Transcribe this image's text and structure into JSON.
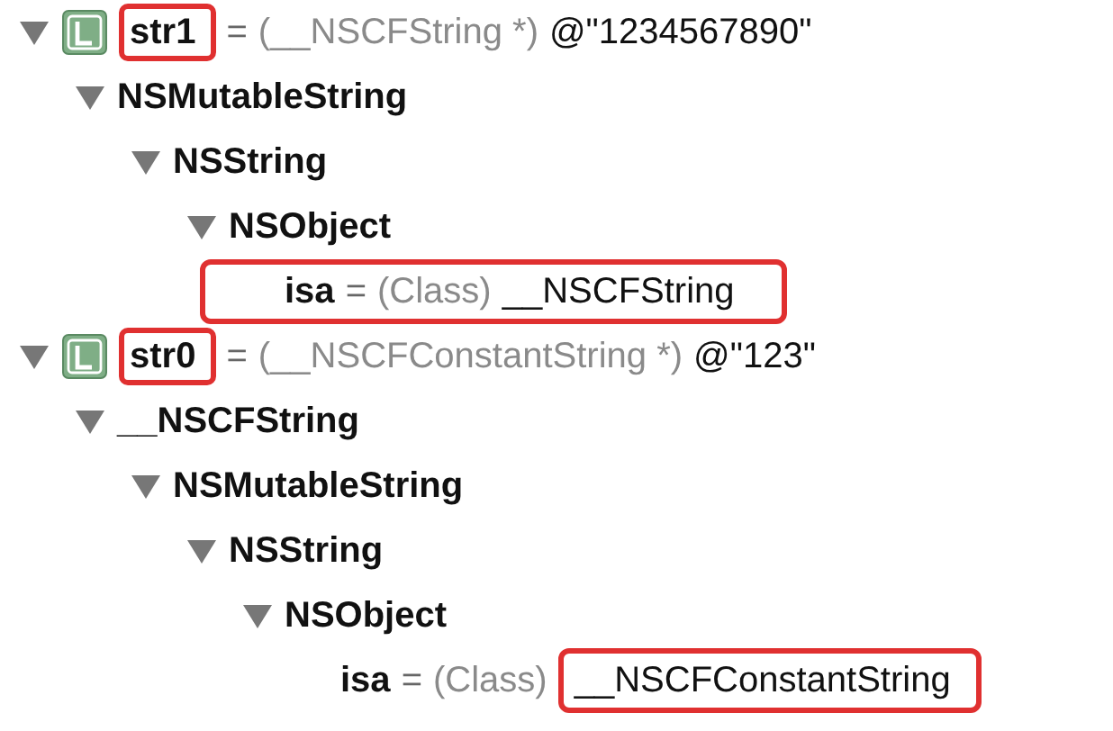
{
  "variables": [
    {
      "local": true,
      "name": "str1",
      "operator": "=",
      "type": "(__NSCFString *)",
      "value": "@\"1234567890\"",
      "expanded": true,
      "name_boxed": true,
      "row_boxed": false,
      "value_boxed": false,
      "children": [
        {
          "local": false,
          "name": "NSMutableString",
          "expanded": true,
          "name_boxed": false,
          "row_boxed": false,
          "value_boxed": false,
          "children": [
            {
              "local": false,
              "name": "NSString",
              "expanded": true,
              "name_boxed": false,
              "row_boxed": false,
              "value_boxed": false,
              "children": [
                {
                  "local": false,
                  "name": "NSObject",
                  "expanded": true,
                  "name_boxed": false,
                  "row_boxed": false,
                  "value_boxed": false,
                  "children": [
                    {
                      "local": false,
                      "name": "isa",
                      "operator": "=",
                      "type": "(Class)",
                      "value": "__NSCFString",
                      "name_boxed": false,
                      "row_boxed": true,
                      "value_boxed": false
                    }
                  ]
                }
              ]
            }
          ]
        }
      ]
    },
    {
      "local": true,
      "name": "str0",
      "operator": "=",
      "type": "(__NSCFConstantString *)",
      "value": "@\"123\"",
      "expanded": true,
      "name_boxed": true,
      "row_boxed": false,
      "value_boxed": false,
      "children": [
        {
          "local": false,
          "name": "__NSCFString",
          "expanded": true,
          "name_boxed": false,
          "row_boxed": false,
          "value_boxed": false,
          "children": [
            {
              "local": false,
              "name": "NSMutableString",
              "expanded": true,
              "name_boxed": false,
              "row_boxed": false,
              "value_boxed": false,
              "children": [
                {
                  "local": false,
                  "name": "NSString",
                  "expanded": true,
                  "name_boxed": false,
                  "row_boxed": false,
                  "value_boxed": false,
                  "children": [
                    {
                      "local": false,
                      "name": "NSObject",
                      "expanded": true,
                      "name_boxed": false,
                      "row_boxed": false,
                      "value_boxed": false,
                      "children": [
                        {
                          "local": false,
                          "name": "isa",
                          "operator": "=",
                          "type": "(Class)",
                          "value": "__NSCFConstantString",
                          "name_boxed": false,
                          "row_boxed": false,
                          "value_boxed": true
                        }
                      ]
                    }
                  ]
                }
              ]
            }
          ]
        }
      ]
    }
  ]
}
